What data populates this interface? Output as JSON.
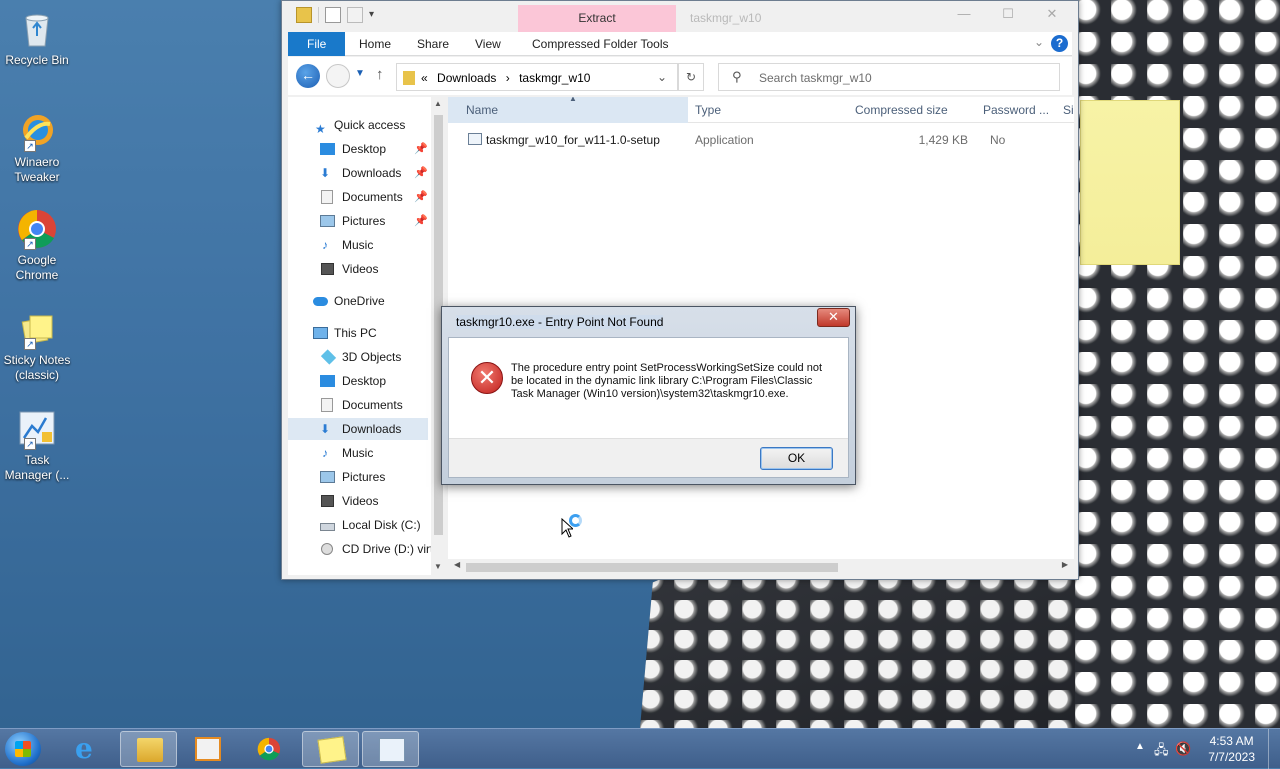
{
  "desktop": {
    "icons": [
      {
        "label": "Recycle Bin"
      },
      {
        "label": "Winaero Tweaker"
      },
      {
        "label": "Google Chrome"
      },
      {
        "label": "Sticky Notes (classic)"
      },
      {
        "label": "Task Manager (..."
      }
    ]
  },
  "explorer": {
    "contextual_tab": "Extract",
    "title": "taskmgr_w10",
    "window_buttons": {
      "minimize": "—",
      "maximize": "☐",
      "close": "✕"
    },
    "ribbon_tabs": [
      "File",
      "Home",
      "Share",
      "View",
      "Compressed Folder Tools"
    ],
    "help": "?",
    "address": {
      "prefix": "«",
      "crumbs": [
        "Downloads",
        "›",
        "taskmgr_w10"
      ]
    },
    "search_placeholder": "Search taskmgr_w10",
    "nav": {
      "quick_access": "Quick access",
      "qa_items": [
        "Desktop",
        "Downloads",
        "Documents",
        "Pictures",
        "Music",
        "Videos"
      ],
      "onedrive": "OneDrive",
      "this_pc": "This PC",
      "pc_items": [
        "3D Objects",
        "Desktop",
        "Documents",
        "Downloads",
        "Music",
        "Pictures",
        "Videos",
        "Local Disk (C:)",
        "CD Drive (D:) virt"
      ],
      "selected": "Downloads"
    },
    "columns": {
      "name": "Name",
      "type": "Type",
      "compressed": "Compressed size",
      "password": "Password ...",
      "size": "Si"
    },
    "files": [
      {
        "name": "taskmgr_w10_for_w11-1.0-setup",
        "type": "Application",
        "compressed": "1,429 KB",
        "password": "No"
      }
    ]
  },
  "dialog": {
    "title": "taskmgr10.exe - Entry Point Not Found",
    "close": "✕",
    "message": "The procedure entry point SetProcessWorkingSetSize could not be located in the dynamic link library C:\\Program Files\\Classic Task Manager (Win10 version)\\system32\\taskmgr10.exe.",
    "ok": "OK"
  },
  "taskbar": {
    "pinned": [
      "Internet Explorer",
      "File Explorer",
      "Media Player",
      "Google Chrome",
      "Sticky Notes",
      "Task Manager"
    ],
    "clock": {
      "time": "4:53 AM",
      "date": "7/7/2023"
    }
  }
}
